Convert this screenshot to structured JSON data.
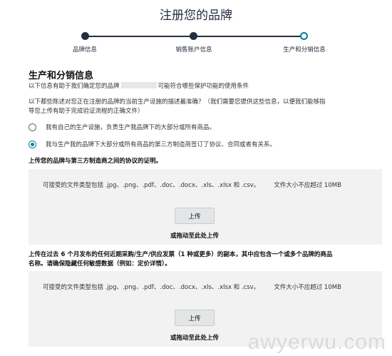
{
  "page": {
    "title": "注册您的品牌"
  },
  "stepper": {
    "steps": [
      {
        "label": "品牌信息",
        "state": "completed"
      },
      {
        "label": "销售账户信息",
        "state": "completed"
      },
      {
        "label": "生产和分销信息",
        "state": "current"
      }
    ]
  },
  "section": {
    "title": "生产和分销信息",
    "intro_prefix": "以下信息有助于我们确定您的品牌",
    "intro_suffix": "可能符合哪些保护功能的使用条件",
    "question_line1": "以下都些陈述对您正在注册的品牌的当前生产设施的描述最准确？（我们需要您提供这些信息，以便我们能够指",
    "question_line2": "导您上传有助于完成验证流程的正确文件）"
  },
  "options": [
    {
      "label": "我有自己的生产设施，负责生产我品牌下的大部分或所有商品。",
      "selected": false
    },
    {
      "label": "我与生产我的品牌下大部分或所有商品的第三方制造商签订了协议、合同或者有关系。",
      "selected": true
    }
  ],
  "upload1": {
    "heading": "上传您的品牌与第三方制造商之间的协议的证明。",
    "accepted_types": "可接受的文件类型包括 .jpg、.png、.pdf、.doc、.docx、.xls、.xlsx 和 .csv。",
    "size_limit": "文件大小不应超过 10MB",
    "button_label": "上传",
    "drag_text": "或拖动至此处上传"
  },
  "upload2": {
    "heading_line1": "上传在过去 6 个月发布的任何近期采购/生产/供应发票（1 种或更多）的副本，其中应包含一个或多个品牌的商品",
    "heading_line2": "名称。请确保隐藏任何敏感数据（例如：定价详情）。",
    "accepted_types": "可接受的文件类型包括 .jpg、.png、.pdf、.doc、.docx、.xls、.xlsx 和 .csv。",
    "size_limit": "文件大小不应超过 10MB",
    "button_label": "上传",
    "drag_text": "或拖动至此处上传"
  },
  "watermark": "awyerwu.com",
  "colors": {
    "stepper": "#232f3e",
    "accent": "#008296",
    "box_background": "#f2f2f2",
    "button_background": "#e3e6e6"
  }
}
